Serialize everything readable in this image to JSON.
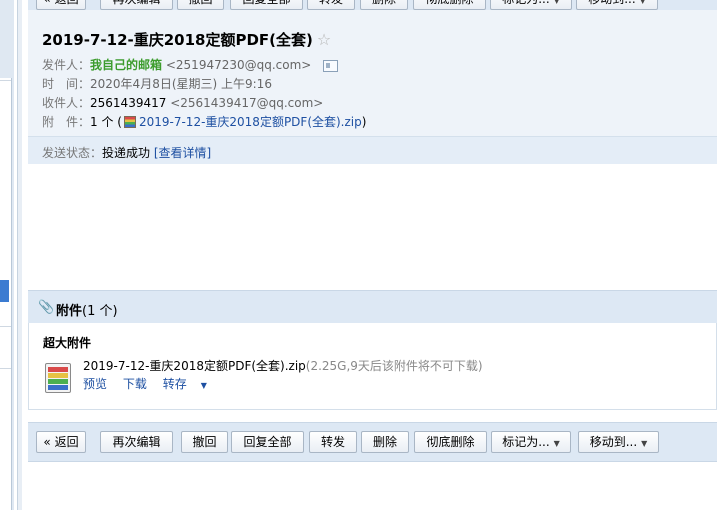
{
  "toolbar": {
    "buttons": [
      {
        "label": "« 返回"
      },
      {
        "label": "再次编辑"
      },
      {
        "label": "撤回"
      },
      {
        "label": "回复全部"
      },
      {
        "label": "转发"
      },
      {
        "label": "删除"
      },
      {
        "label": "彻底删除"
      },
      {
        "label": "标记为...",
        "caret": "▼"
      },
      {
        "label": "移动到...",
        "caret": "▼"
      }
    ]
  },
  "mail": {
    "subject": "2019-7-12-重庆2018定额PDF(全套)",
    "star_icon": "☆",
    "sender_label": "发件人：",
    "sender_name": "我自己的邮箱",
    "sender_addr": "<251947230@qq.com>",
    "time_label": "时　间：",
    "time_value": "2020年4月8日(星期三) 上午9:16",
    "to_label": "收件人：",
    "to_name": "2561439417",
    "to_addr": "<2561439417@qq.com>",
    "attach_label": "附　件：",
    "attach_count": "1 个 (",
    "attach_file": "2019-7-12-重庆2018定额PDF(全套).zip",
    "attach_close": ")",
    "status_label": "发送状态：",
    "status_value": "投递成功",
    "status_link": "[查看详情]"
  },
  "attachments": {
    "header_title": "附件",
    "header_count": "(1 个)",
    "section_title": "超大附件",
    "file_name": "2019-7-12-重庆2018定额PDF(全套).zip",
    "file_meta": "(2.25G,9天后该附件将不可下载)",
    "actions": {
      "preview": "预览",
      "download": "下载",
      "save": "转存"
    }
  }
}
